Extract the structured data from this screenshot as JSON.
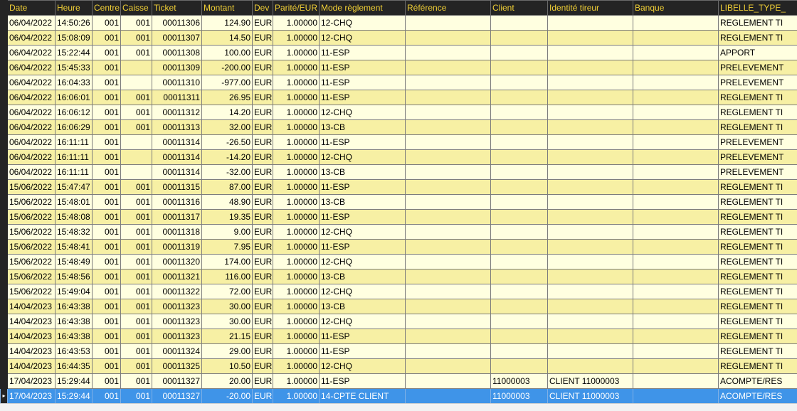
{
  "grid": {
    "columns": [
      "Date",
      "Heure",
      "Centre",
      "Caisse",
      "Ticket",
      "Montant",
      "Dev",
      "Parité/EUR",
      "Mode règlement",
      "Référence",
      "Client",
      "Identité tireur",
      "Banque",
      "LIBELLE_TYPE_"
    ],
    "selected_row_marker": "▸",
    "rows": [
      [
        "06/04/2022",
        "14:50:26",
        "001",
        "001",
        "00011306",
        "124.90",
        "EUR",
        "1.00000",
        "12-CHQ",
        "",
        "",
        "",
        "",
        "REGLEMENT TI"
      ],
      [
        "06/04/2022",
        "15:08:09",
        "001",
        "001",
        "00011307",
        "14.50",
        "EUR",
        "1.00000",
        "12-CHQ",
        "",
        "",
        "",
        "",
        "REGLEMENT TI"
      ],
      [
        "06/04/2022",
        "15:22:44",
        "001",
        "001",
        "00011308",
        "100.00",
        "EUR",
        "1.00000",
        "11-ESP",
        "",
        "",
        "",
        "",
        "APPORT"
      ],
      [
        "06/04/2022",
        "15:45:33",
        "001",
        "",
        "00011309",
        "-200.00",
        "EUR",
        "1.00000",
        "11-ESP",
        "",
        "",
        "",
        "",
        "PRELEVEMENT"
      ],
      [
        "06/04/2022",
        "16:04:33",
        "001",
        "",
        "00011310",
        "-977.00",
        "EUR",
        "1.00000",
        "11-ESP",
        "",
        "",
        "",
        "",
        "PRELEVEMENT"
      ],
      [
        "06/04/2022",
        "16:06:01",
        "001",
        "001",
        "00011311",
        "26.95",
        "EUR",
        "1.00000",
        "11-ESP",
        "",
        "",
        "",
        "",
        "REGLEMENT TI"
      ],
      [
        "06/04/2022",
        "16:06:12",
        "001",
        "001",
        "00011312",
        "14.20",
        "EUR",
        "1.00000",
        "12-CHQ",
        "",
        "",
        "",
        "",
        "REGLEMENT TI"
      ],
      [
        "06/04/2022",
        "16:06:29",
        "001",
        "001",
        "00011313",
        "32.00",
        "EUR",
        "1.00000",
        "13-CB",
        "",
        "",
        "",
        "",
        "REGLEMENT TI"
      ],
      [
        "06/04/2022",
        "16:11:11",
        "001",
        "",
        "00011314",
        "-26.50",
        "EUR",
        "1.00000",
        "11-ESP",
        "",
        "",
        "",
        "",
        "PRELEVEMENT"
      ],
      [
        "06/04/2022",
        "16:11:11",
        "001",
        "",
        "00011314",
        "-14.20",
        "EUR",
        "1.00000",
        "12-CHQ",
        "",
        "",
        "",
        "",
        "PRELEVEMENT"
      ],
      [
        "06/04/2022",
        "16:11:11",
        "001",
        "",
        "00011314",
        "-32.00",
        "EUR",
        "1.00000",
        "13-CB",
        "",
        "",
        "",
        "",
        "PRELEVEMENT"
      ],
      [
        "15/06/2022",
        "15:47:47",
        "001",
        "001",
        "00011315",
        "87.00",
        "EUR",
        "1.00000",
        "11-ESP",
        "",
        "",
        "",
        "",
        "REGLEMENT TI"
      ],
      [
        "15/06/2022",
        "15:48:01",
        "001",
        "001",
        "00011316",
        "48.90",
        "EUR",
        "1.00000",
        "13-CB",
        "",
        "",
        "",
        "",
        "REGLEMENT TI"
      ],
      [
        "15/06/2022",
        "15:48:08",
        "001",
        "001",
        "00011317",
        "19.35",
        "EUR",
        "1.00000",
        "11-ESP",
        "",
        "",
        "",
        "",
        "REGLEMENT TI"
      ],
      [
        "15/06/2022",
        "15:48:32",
        "001",
        "001",
        "00011318",
        "9.00",
        "EUR",
        "1.00000",
        "12-CHQ",
        "",
        "",
        "",
        "",
        "REGLEMENT TI"
      ],
      [
        "15/06/2022",
        "15:48:41",
        "001",
        "001",
        "00011319",
        "7.95",
        "EUR",
        "1.00000",
        "11-ESP",
        "",
        "",
        "",
        "",
        "REGLEMENT TI"
      ],
      [
        "15/06/2022",
        "15:48:49",
        "001",
        "001",
        "00011320",
        "174.00",
        "EUR",
        "1.00000",
        "12-CHQ",
        "",
        "",
        "",
        "",
        "REGLEMENT TI"
      ],
      [
        "15/06/2022",
        "15:48:56",
        "001",
        "001",
        "00011321",
        "116.00",
        "EUR",
        "1.00000",
        "13-CB",
        "",
        "",
        "",
        "",
        "REGLEMENT TI"
      ],
      [
        "15/06/2022",
        "15:49:04",
        "001",
        "001",
        "00011322",
        "72.00",
        "EUR",
        "1.00000",
        "12-CHQ",
        "",
        "",
        "",
        "",
        "REGLEMENT TI"
      ],
      [
        "14/04/2023",
        "16:43:38",
        "001",
        "001",
        "00011323",
        "30.00",
        "EUR",
        "1.00000",
        "13-CB",
        "",
        "",
        "",
        "",
        "REGLEMENT TI"
      ],
      [
        "14/04/2023",
        "16:43:38",
        "001",
        "001",
        "00011323",
        "30.00",
        "EUR",
        "1.00000",
        "12-CHQ",
        "",
        "",
        "",
        "",
        "REGLEMENT TI"
      ],
      [
        "14/04/2023",
        "16:43:38",
        "001",
        "001",
        "00011323",
        "21.15",
        "EUR",
        "1.00000",
        "11-ESP",
        "",
        "",
        "",
        "",
        "REGLEMENT TI"
      ],
      [
        "14/04/2023",
        "16:43:53",
        "001",
        "001",
        "00011324",
        "29.00",
        "EUR",
        "1.00000",
        "11-ESP",
        "",
        "",
        "",
        "",
        "REGLEMENT TI"
      ],
      [
        "14/04/2023",
        "16:44:35",
        "001",
        "001",
        "00011325",
        "10.50",
        "EUR",
        "1.00000",
        "12-CHQ",
        "",
        "",
        "",
        "",
        "REGLEMENT TI"
      ],
      [
        "17/04/2023",
        "15:29:44",
        "001",
        "001",
        "00011327",
        "20.00",
        "EUR",
        "1.00000",
        "11-ESP",
        "",
        "11000003",
        "CLIENT  11000003",
        "",
        "ACOMPTE/RES"
      ],
      [
        "17/04/2023",
        "15:29:44",
        "001",
        "001",
        "00011327",
        "-20.00",
        "EUR",
        "1.00000",
        "14-CPTE CLIENT",
        "",
        "11000003",
        "CLIENT  11000003",
        "",
        "ACOMPTE/RES"
      ]
    ],
    "selected_index": 25
  },
  "colors": {
    "header_bg": "#242424",
    "header_text": "#f0cf36",
    "row_light": "#ffffe0",
    "row_dark": "#f7f0a4",
    "selection": "#3f94e8"
  }
}
